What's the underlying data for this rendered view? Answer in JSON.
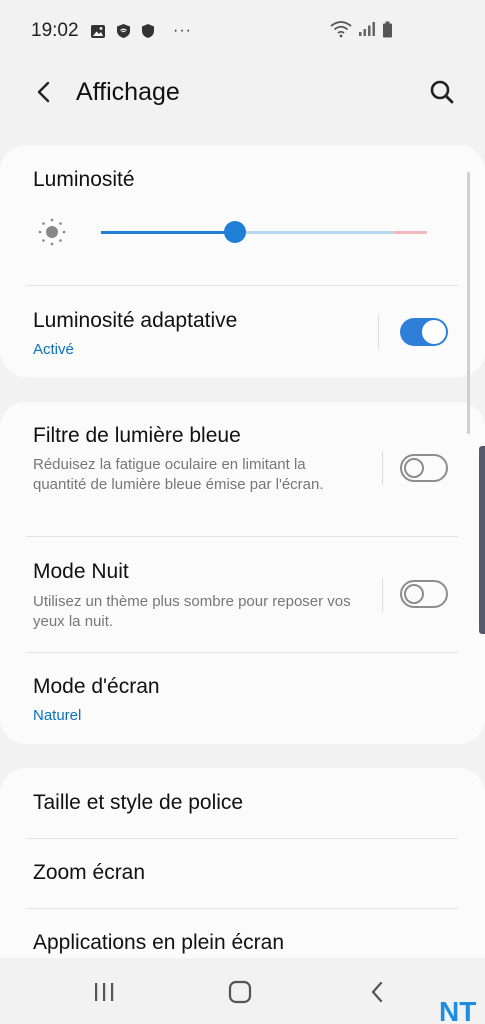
{
  "status_bar": {
    "time": "19:02",
    "dots": "···"
  },
  "header": {
    "title": "Affichage"
  },
  "display": {
    "brightness": {
      "title": "Luminosité",
      "level": 0.41
    },
    "adaptive_brightness": {
      "title": "Luminosité adaptative",
      "status": "Activé",
      "enabled": true
    },
    "blue_light_filter": {
      "title": "Filtre de lumière bleue",
      "description": "Réduisez la fatigue oculaire en limitant la quantité de lumière bleue émise par l'écran.",
      "enabled": false
    },
    "night_mode": {
      "title": "Mode Nuit",
      "description": "Utilisez un thème plus sombre pour reposer vos yeux la nuit.",
      "enabled": false
    },
    "screen_mode": {
      "title": "Mode d'écran",
      "value": "Naturel"
    },
    "font_size_style": {
      "title": "Taille et style de police"
    },
    "screen_zoom": {
      "title": "Zoom écran"
    },
    "fullscreen_apps": {
      "title": "Applications en plein écran"
    }
  },
  "watermark": {
    "text": "NT"
  },
  "colors": {
    "accent": "#1f7ed6",
    "link": "#0a71c0",
    "background": "#f2f2f2",
    "card": "#fbfbfb"
  }
}
